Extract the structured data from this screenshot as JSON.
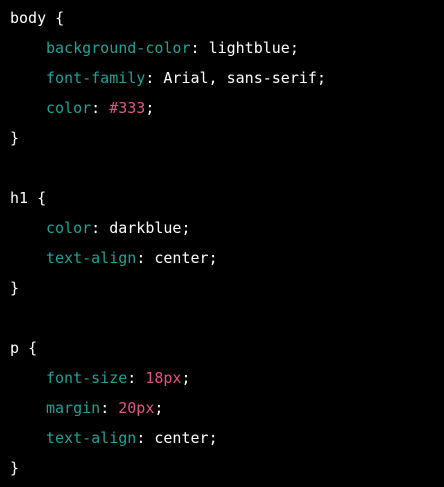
{
  "colors": {
    "background": "#000000",
    "default_text": "#ffffff",
    "property": "#1aa39a",
    "number": "#e8508a"
  },
  "code": {
    "lines": [
      {
        "kind": "open",
        "selector": "body",
        "brace": "{"
      },
      {
        "kind": "decl",
        "property": "background-color",
        "colon": ":",
        "value": "lightblue",
        "value_type": "keyword",
        "semi": ";"
      },
      {
        "kind": "decl",
        "property": "font-family",
        "colon": ":",
        "value": "Arial, sans-serif",
        "value_type": "keyword",
        "semi": ";"
      },
      {
        "kind": "decl",
        "property": "color",
        "colon": ":",
        "value": "#333",
        "value_type": "number",
        "semi": ";"
      },
      {
        "kind": "close",
        "brace": "}"
      },
      {
        "kind": "blank"
      },
      {
        "kind": "open",
        "selector": "h1",
        "brace": "{"
      },
      {
        "kind": "decl",
        "property": "color",
        "colon": ":",
        "value": "darkblue",
        "value_type": "keyword",
        "semi": ";"
      },
      {
        "kind": "decl",
        "property": "text-align",
        "colon": ":",
        "value": "center",
        "value_type": "keyword",
        "semi": ";"
      },
      {
        "kind": "close",
        "brace": "}"
      },
      {
        "kind": "blank"
      },
      {
        "kind": "open",
        "selector": "p",
        "brace": "{"
      },
      {
        "kind": "decl",
        "property": "font-size",
        "colon": ":",
        "value": "18px",
        "value_type": "number",
        "semi": ";"
      },
      {
        "kind": "decl",
        "property": "margin",
        "colon": ":",
        "value": "20px",
        "value_type": "number",
        "semi": ";"
      },
      {
        "kind": "decl",
        "property": "text-align",
        "colon": ":",
        "value": "center",
        "value_type": "keyword",
        "semi": ";"
      },
      {
        "kind": "close",
        "brace": "}"
      }
    ]
  }
}
